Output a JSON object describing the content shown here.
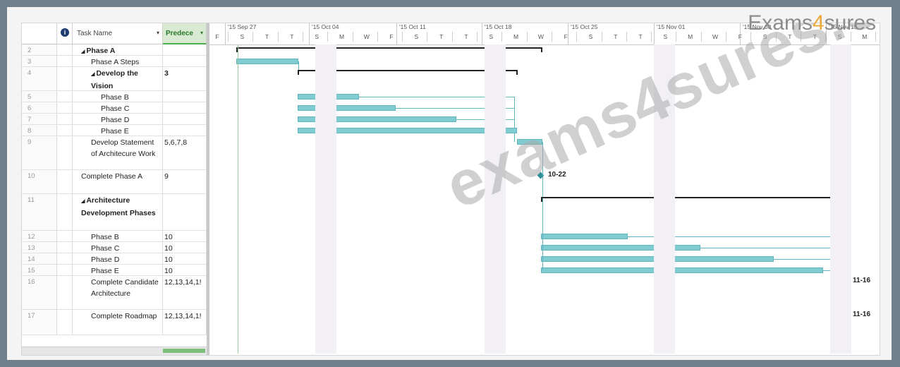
{
  "header": {
    "info_icon": "info-icon",
    "task_name": "Task Name",
    "predecessors": "Predece",
    "weeks": [
      "'15 Sep 27",
      "'15 Oct 04",
      "'15 Oct 11",
      "'15 Oct 18",
      "'15 Oct 25",
      "'15 Nov 01",
      "'15 Nov 08",
      "'15 Nov 15"
    ],
    "days": [
      "F",
      "S",
      "T",
      "T",
      "S",
      "M",
      "W",
      "F",
      "S",
      "T",
      "T",
      "S",
      "M",
      "W",
      "F",
      "S",
      "T",
      "T",
      "S",
      "M",
      "W",
      "F",
      "S",
      "T",
      "T",
      "S",
      "M"
    ]
  },
  "rows": [
    {
      "id": "2",
      "name": "Phase A",
      "pred": "",
      "summary": true,
      "level": 0
    },
    {
      "id": "3",
      "name": "Phase A Steps",
      "pred": "",
      "summary": false,
      "level": 1
    },
    {
      "id": "4",
      "name": "Develop the Vision",
      "pred": "3",
      "summary": true,
      "level": 1
    },
    {
      "id": "5",
      "name": "Phase B",
      "pred": "",
      "summary": false,
      "level": 2
    },
    {
      "id": "6",
      "name": "Phase C",
      "pred": "",
      "summary": false,
      "level": 2
    },
    {
      "id": "7",
      "name": "Phase D",
      "pred": "",
      "summary": false,
      "level": 2
    },
    {
      "id": "8",
      "name": "Phase E",
      "pred": "",
      "summary": false,
      "level": 2
    },
    {
      "id": "9",
      "name": "Develop Statement of Architecure Work",
      "pred": "5,6,7,8",
      "summary": false,
      "level": 1
    },
    {
      "id": "10",
      "name": "Complete Phase A",
      "pred": "9",
      "summary": false,
      "level": 0
    },
    {
      "id": "11",
      "name": "Architecture Development Phases",
      "pred": "",
      "summary": true,
      "level": 0
    },
    {
      "id": "12",
      "name": "Phase B",
      "pred": "10",
      "summary": false,
      "level": 1
    },
    {
      "id": "13",
      "name": "Phase C",
      "pred": "10",
      "summary": false,
      "level": 1
    },
    {
      "id": "14",
      "name": "Phase D",
      "pred": "10",
      "summary": false,
      "level": 1
    },
    {
      "id": "15",
      "name": "Phase E",
      "pred": "10",
      "summary": false,
      "level": 1
    },
    {
      "id": "16",
      "name": "Complete Candidate Architecture",
      "pred": "12,13,14,1!",
      "summary": false,
      "level": 1
    },
    {
      "id": "17",
      "name": "Complete Roadmap",
      "pred": "12,13,14,1!",
      "summary": false,
      "level": 1
    }
  ],
  "milestones": {
    "complete_phase_a": "10-22",
    "candidate_arch": "11-16",
    "roadmap": "11-16"
  },
  "watermark": "exams4sures.com",
  "brand": {
    "prefix": "Exams",
    "four": "4",
    "suffix": "sures"
  },
  "colors": {
    "bar": "#7fcdd3",
    "milestone": "#2e8f97",
    "summary": "#222222"
  }
}
